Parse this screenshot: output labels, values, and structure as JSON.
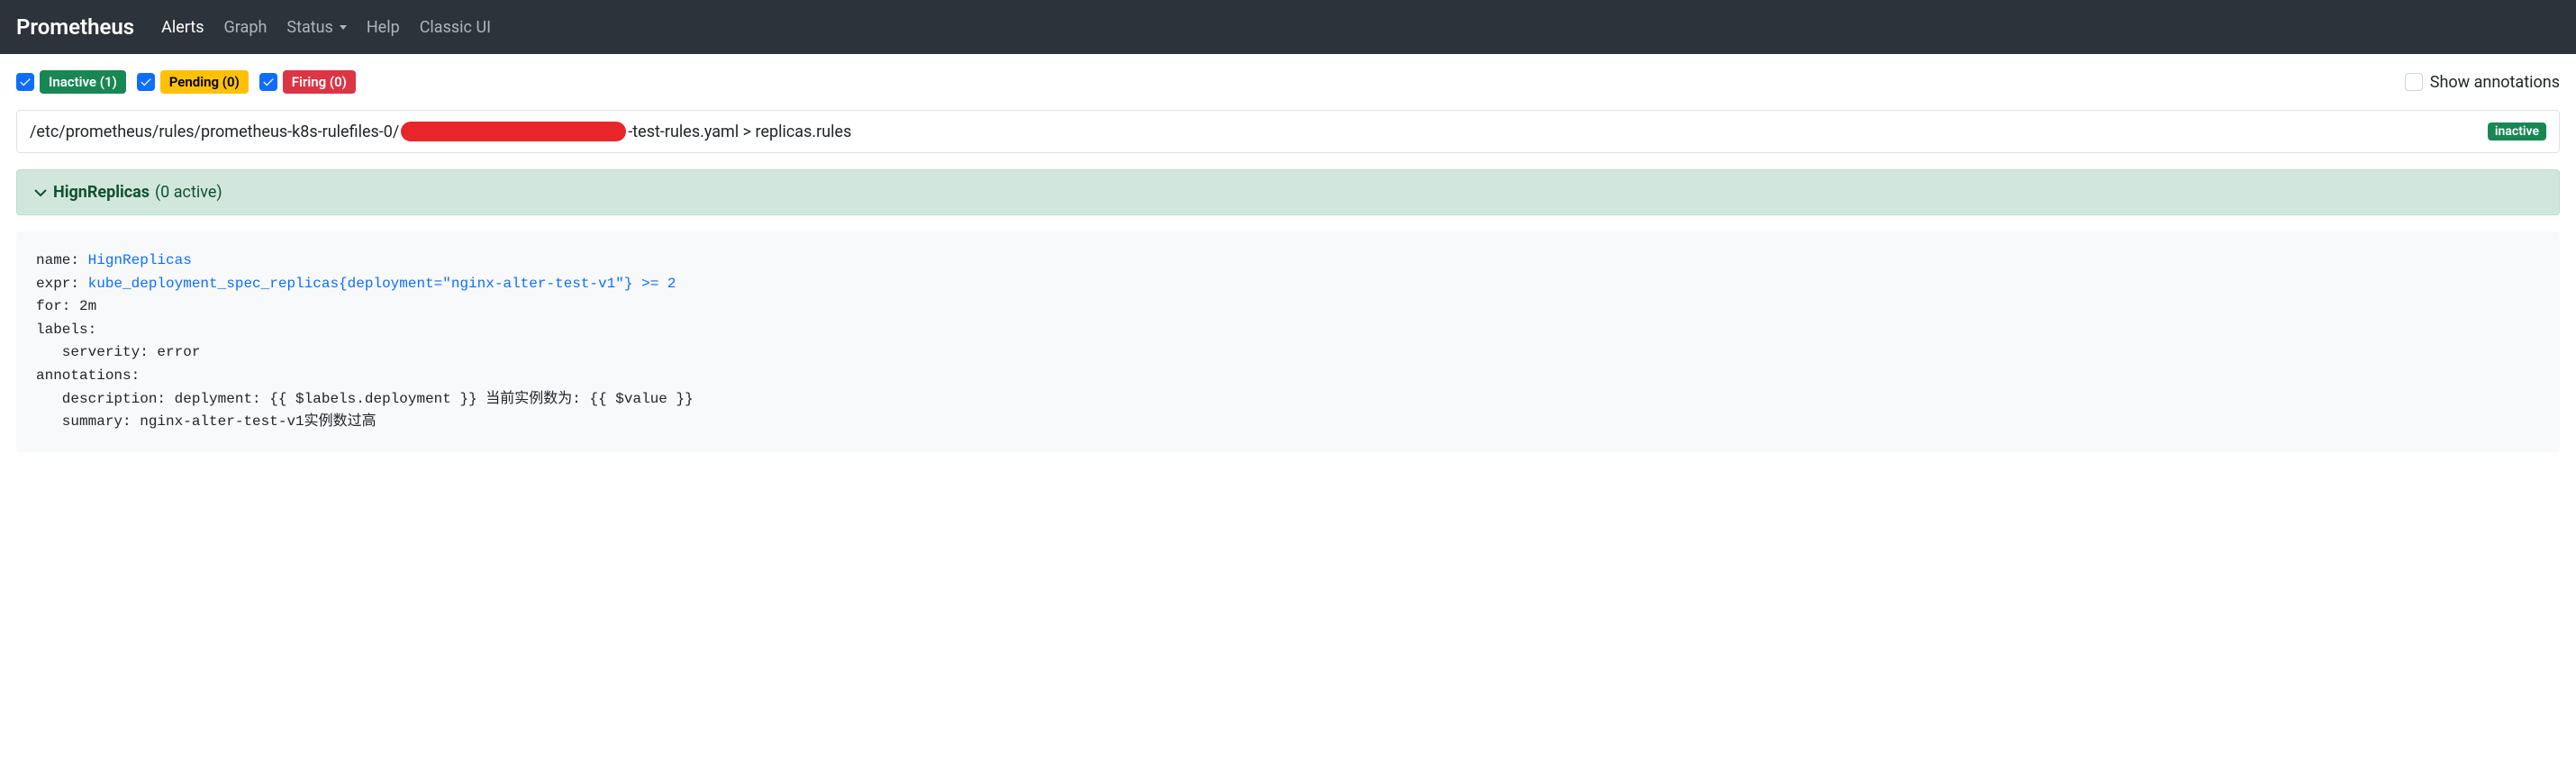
{
  "navbar": {
    "brand": "Prometheus",
    "items": [
      {
        "label": "Alerts",
        "active": true
      },
      {
        "label": "Graph"
      },
      {
        "label": "Status",
        "dropdown": true
      },
      {
        "label": "Help"
      },
      {
        "label": "Classic UI"
      }
    ]
  },
  "filters": {
    "inactive": {
      "label": "Inactive (1)",
      "checked": true
    },
    "pending": {
      "label": "Pending (0)",
      "checked": true
    },
    "firing": {
      "label": "Firing (0)",
      "checked": true
    },
    "show_annotations": {
      "label": "Show annotations",
      "checked": false
    }
  },
  "rule_file": {
    "path_prefix": "/etc/prometheus/rules/prometheus-k8s-rulefiles-0/",
    "path_suffix": "-test-rules.yaml > replicas.rules",
    "status_badge": "inactive"
  },
  "rule_group": {
    "name": "HignReplicas",
    "active_text": "(0 active)"
  },
  "rule_details": {
    "name_label": "name: ",
    "name_value": "HignReplicas",
    "expr_label": "expr: ",
    "expr_value": "kube_deployment_spec_replicas{deployment=\"nginx-alter-test-v1\"} >= 2",
    "for_line": "for: 2m",
    "labels_line": "labels:",
    "labels_severity": "   serverity: error",
    "annotations_line": "annotations:",
    "annotations_description": "   description: deplyment: {{ $labels.deployment }} 当前实例数为: {{ $value }}",
    "annotations_summary": "   summary: nginx-alter-test-v1实例数过高"
  }
}
